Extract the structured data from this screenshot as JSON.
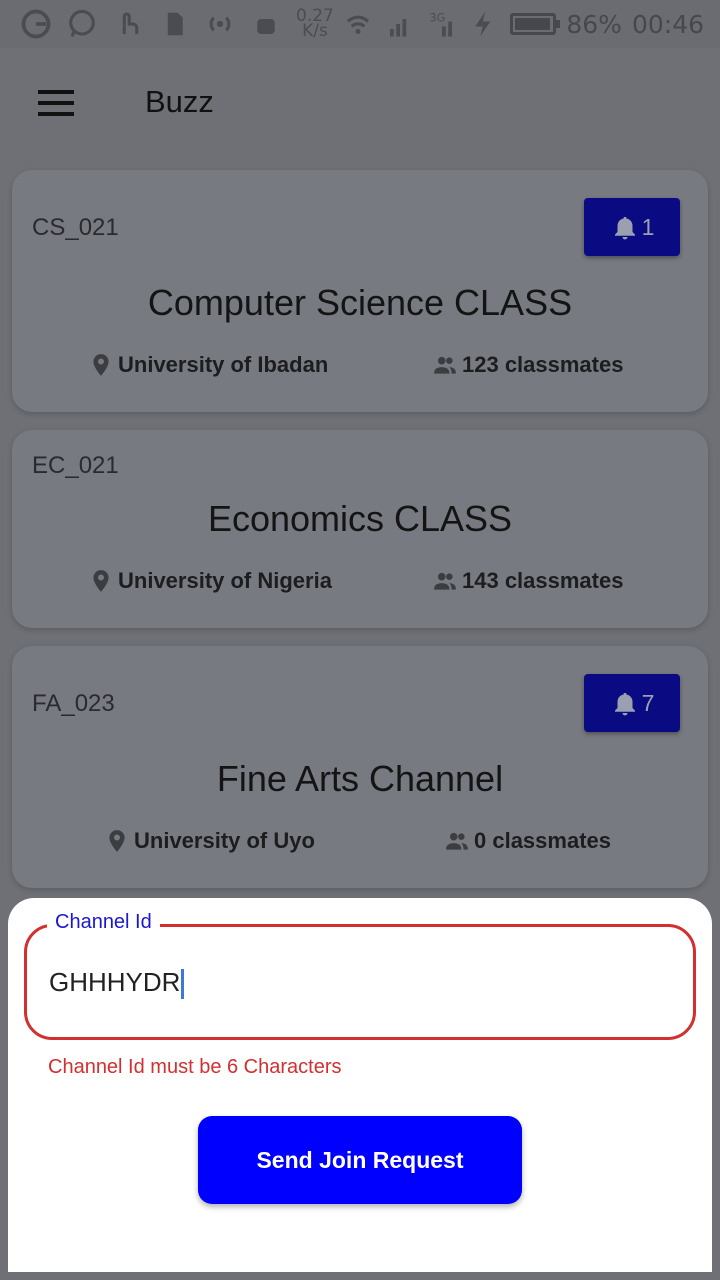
{
  "status_bar": {
    "icons": [
      "google-icon",
      "whatsapp-icon",
      "touch-icon",
      "sd-card-icon",
      "hotspot-icon",
      "android-icon"
    ],
    "net_speed": "0.27",
    "net_speed_unit": "K/s",
    "battery": "86%",
    "time": "00:46",
    "signal_label": "3G"
  },
  "app_bar": {
    "title": "Buzz"
  },
  "channels": [
    {
      "code": "CS_021",
      "title": "Computer Science CLASS",
      "university": "University of Ibadan",
      "classmates": "123 classmates",
      "notifications": "1"
    },
    {
      "code": "EC_021",
      "title": "Economics CLASS",
      "university": "University of Nigeria",
      "classmates": "143 classmates"
    },
    {
      "code": "FA_023",
      "title": "Fine Arts Channel",
      "university": "University of Uyo",
      "classmates": "0 classmates",
      "notifications": "7"
    }
  ],
  "join_sheet": {
    "field_label": "Channel Id",
    "field_value": "GHHHYDR",
    "error": "Channel Id must be 6 Characters",
    "button_label": "Send Join Request"
  },
  "colors": {
    "accent": "#0000ff",
    "badge": "#0a0a82",
    "error": "#d32f2f",
    "label": "#1a16d6"
  }
}
